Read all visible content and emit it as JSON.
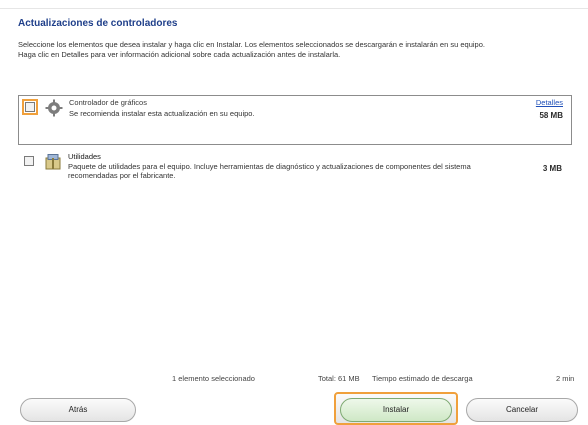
{
  "window": {
    "title": "Actualizaciones de controladores"
  },
  "intro": {
    "line1": "Seleccione los elementos que desea instalar y haga clic en Instalar. Los elementos seleccionados se descargarán e instalarán en su equipo.",
    "line2": "Haga clic en Detalles para ver información adicional sobre cada actualización antes de instalarla."
  },
  "items": [
    {
      "name": "Controlador de gráficos",
      "description": "Se recomienda instalar esta actualización en su equipo.",
      "link": "Detalles",
      "size": "58 MB",
      "checked": false,
      "icon": "gear-icon"
    },
    {
      "name": "Utilidades",
      "description": "Paquete de utilidades para el equipo. Incluye herramientas de diagnóstico y actualizaciones de componentes del sistema recomendadas por el fabricante.",
      "size": "3 MB",
      "checked": false,
      "icon": "package-icon"
    }
  ],
  "summary": {
    "selected": "1 elemento seleccionado",
    "total": "Total: 61 MB",
    "download": "Tiempo estimado de descarga",
    "time": "2 min"
  },
  "buttons": {
    "back": "Atrás",
    "install": "Instalar",
    "cancel": "Cancelar"
  }
}
